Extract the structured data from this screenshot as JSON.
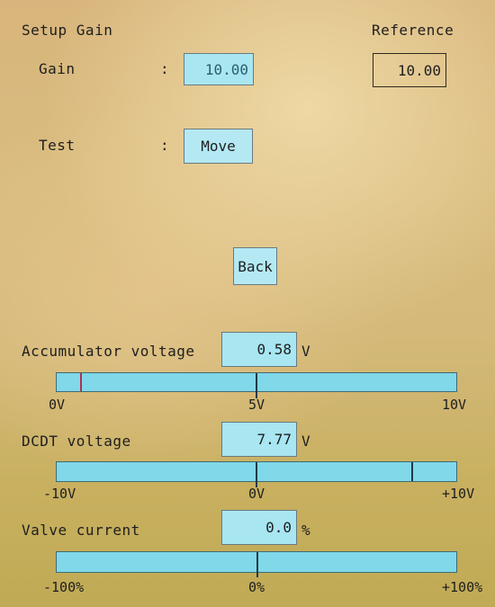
{
  "header": {
    "title": "Setup Gain",
    "reference_label": "Reference"
  },
  "gain": {
    "label": "Gain",
    "separator": ":",
    "value": "10.00",
    "reference_value": "10.00"
  },
  "test": {
    "label": "Test",
    "separator": ":",
    "button_label": "Move"
  },
  "back_button_label": "Back",
  "accumulator": {
    "label": "Accumulator voltage",
    "value": "0.58",
    "unit": "V",
    "scale": [
      "0V",
      "5V",
      "10V"
    ],
    "level_fraction": 0.058
  },
  "dcdt": {
    "label": "DCDT voltage",
    "value": "7.77",
    "unit": "V",
    "scale": [
      "-10V",
      "0V",
      "+10V"
    ],
    "level_fraction": 0.8885
  },
  "valve": {
    "label": "Valve current",
    "value": "0.0",
    "unit": "%",
    "scale": [
      "-100%",
      "0%",
      "+100%"
    ],
    "level_fraction": 0.5
  },
  "colors": {
    "field": "#a8e6f2",
    "bar": "#80d8e9",
    "marker": "#b03050"
  }
}
